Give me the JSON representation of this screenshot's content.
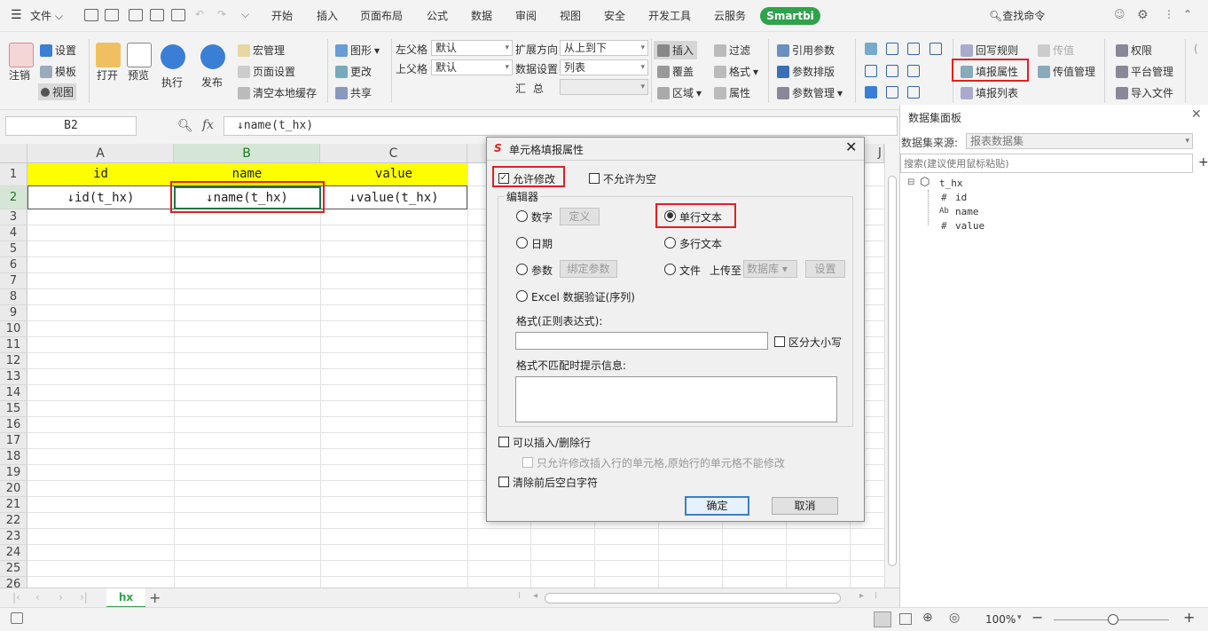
{
  "menubar": {
    "file_menu": "文件",
    "tabs": [
      "开始",
      "插入",
      "页面布局",
      "公式",
      "数据",
      "审阅",
      "视图",
      "安全",
      "开发工具",
      "云服务"
    ],
    "smartbi_tab": "Smartbi",
    "search_command": "查找命令"
  },
  "ribbon": {
    "logout": "注销",
    "settings": "设置",
    "template": "模板",
    "view": "视图",
    "open": "打开",
    "preview": "预览",
    "execute": "执行",
    "publish": "发布",
    "macro": "宏管理",
    "page_setup": "页面设置",
    "clear_cache": "清空本地缓存",
    "chart": "图形",
    "change": "更改",
    "share": "共享",
    "left_parent_label": "左父格",
    "left_parent_value": "默认",
    "top_parent_label": "上父格",
    "top_parent_value": "默认",
    "expand_direction_label": "扩展方向",
    "expand_direction_value": "从上到下",
    "data_setting_label": "数据设置",
    "data_setting_value": "列表",
    "summary_label": "汇  总",
    "insert": "插入",
    "cover": "覆盖",
    "region": "区域",
    "filter": "过滤",
    "format": "格式",
    "property": "属性",
    "ref_param": "引用参数",
    "param_layout": "参数排版",
    "param_manage": "参数管理",
    "writeback_rule": "回写规则",
    "fill_property": "填报属性",
    "fill_list": "填报列表",
    "transfer_value": "传值",
    "transfer_manage": "传值管理",
    "permission": "权限",
    "platform_manage": "平台管理",
    "import_file": "导入文件"
  },
  "formula_bar": {
    "cell_ref": "B2",
    "fx": "fx",
    "formula": "↓name(t_hx)"
  },
  "sheet": {
    "columns": [
      "A",
      "B",
      "C"
    ],
    "rows": [
      "1",
      "2",
      "3",
      "4",
      "5",
      "6",
      "7",
      "8",
      "9",
      "10",
      "11",
      "12",
      "13",
      "14",
      "15",
      "16",
      "17",
      "18",
      "19",
      "20",
      "21",
      "22",
      "23",
      "24",
      "25",
      "26"
    ],
    "header_row": [
      "id",
      "name",
      "value"
    ],
    "data_row": [
      "↓id(t_hx)",
      "↓name(t_hx)",
      "↓value(t_hx)"
    ],
    "tab_name": "hx",
    "header_fill": "#ffff00"
  },
  "dialog": {
    "title": "单元格填报属性",
    "allow_modify": "允许修改",
    "not_null": "不允许为空",
    "editor_label": "编辑器",
    "number": "数字",
    "define": "定义",
    "single_text": "单行文本",
    "date": "日期",
    "multi_text": "多行文本",
    "param": "参数",
    "bind_param": "绑定参数",
    "file": "文件",
    "upload_to": "上传至",
    "database": "数据库",
    "setting": "设置",
    "excel_validation": "Excel 数据验证(序列)",
    "format_label": "格式(正则表达式):",
    "case_sensitive": "区分大小写",
    "mismatch_label": "格式不匹配时提示信息:",
    "can_insert_delete": "可以插入/删除行",
    "only_inserted": "只允许修改插入行的单元格,原始行的单元格不能修改",
    "trim_spaces": "清除前后空白字符",
    "ok": "确定",
    "cancel": "取消"
  },
  "dataset_panel": {
    "title": "数据集面板",
    "source_label": "数据集来源:",
    "source_value": "报表数据集",
    "search_placeholder": "搜索(建议使用鼠标粘贴)",
    "tree_root": "t_hx",
    "fields": [
      {
        "type": "#",
        "name": "id"
      },
      {
        "type": "Ab",
        "name": "name"
      },
      {
        "type": "#",
        "name": "value"
      }
    ]
  },
  "status": {
    "zoom": "100%"
  }
}
